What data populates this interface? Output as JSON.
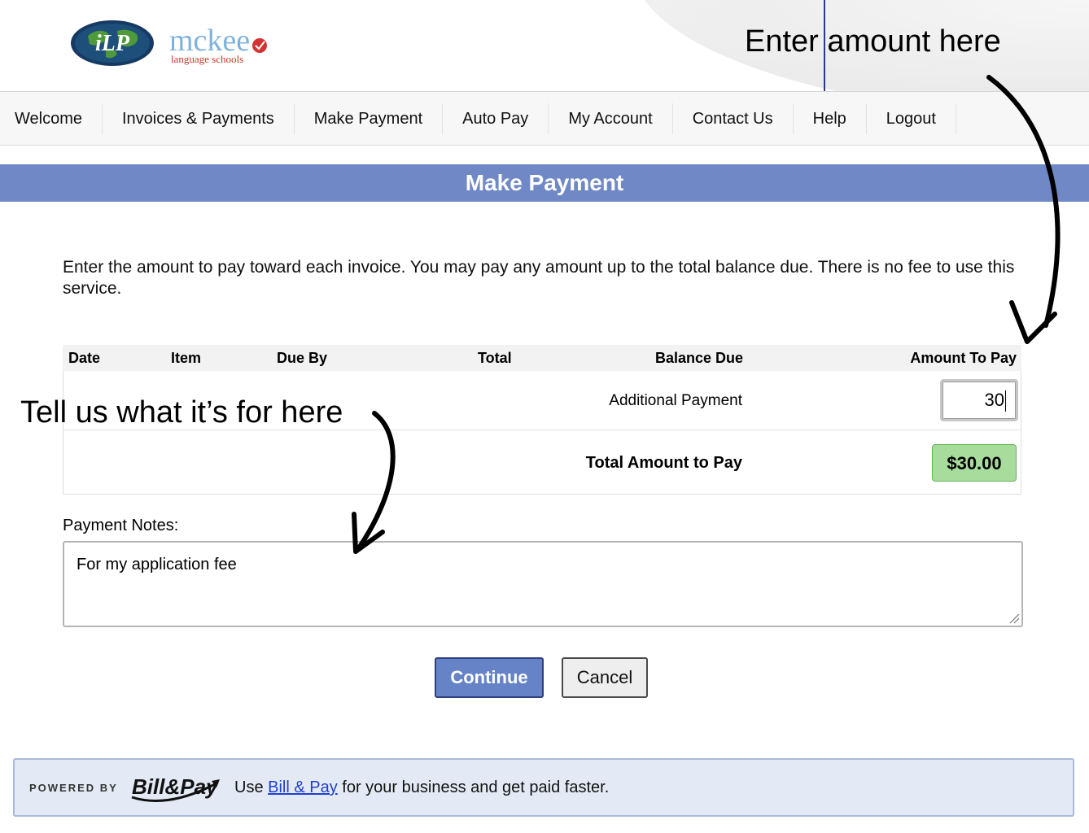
{
  "header": {
    "logo_badge_text": "iLP",
    "logo_name": "mckee",
    "logo_tagline": "language schools",
    "annotation": "Enter amount here"
  },
  "nav": {
    "items": [
      "Welcome",
      "Invoices & Payments",
      "Make Payment",
      "Auto Pay",
      "My Account",
      "Contact Us",
      "Help",
      "Logout"
    ]
  },
  "page": {
    "title": "Make Payment",
    "intro": "Enter the amount to pay toward each invoice. You may pay any amount up to the total balance due. There is no fee to use this service."
  },
  "table": {
    "columns": [
      "Date",
      "Item",
      "Due By",
      "Total",
      "Balance Due",
      "Amount To Pay"
    ],
    "additional_payment_label": "Additional Payment",
    "additional_payment_value": "30",
    "total_label": "Total Amount to Pay",
    "total_value": "$30.00"
  },
  "notes": {
    "label": "Payment Notes:",
    "value": "For my application fee",
    "annotation": "Tell us what it’s for here"
  },
  "buttons": {
    "continue": "Continue",
    "cancel": "Cancel"
  },
  "footer": {
    "powered_by": "POWERED BY",
    "logo_text": "Bill&Pay",
    "text_before": "Use ",
    "link": "Bill & Pay",
    "text_after": " for your business and get paid faster."
  },
  "colors": {
    "title_band": "#7089c6",
    "total_badge": "#a7dc9d",
    "continue_button": "#6783c8",
    "footer_bg": "#e4eaf5",
    "link": "#1f3fd0"
  }
}
